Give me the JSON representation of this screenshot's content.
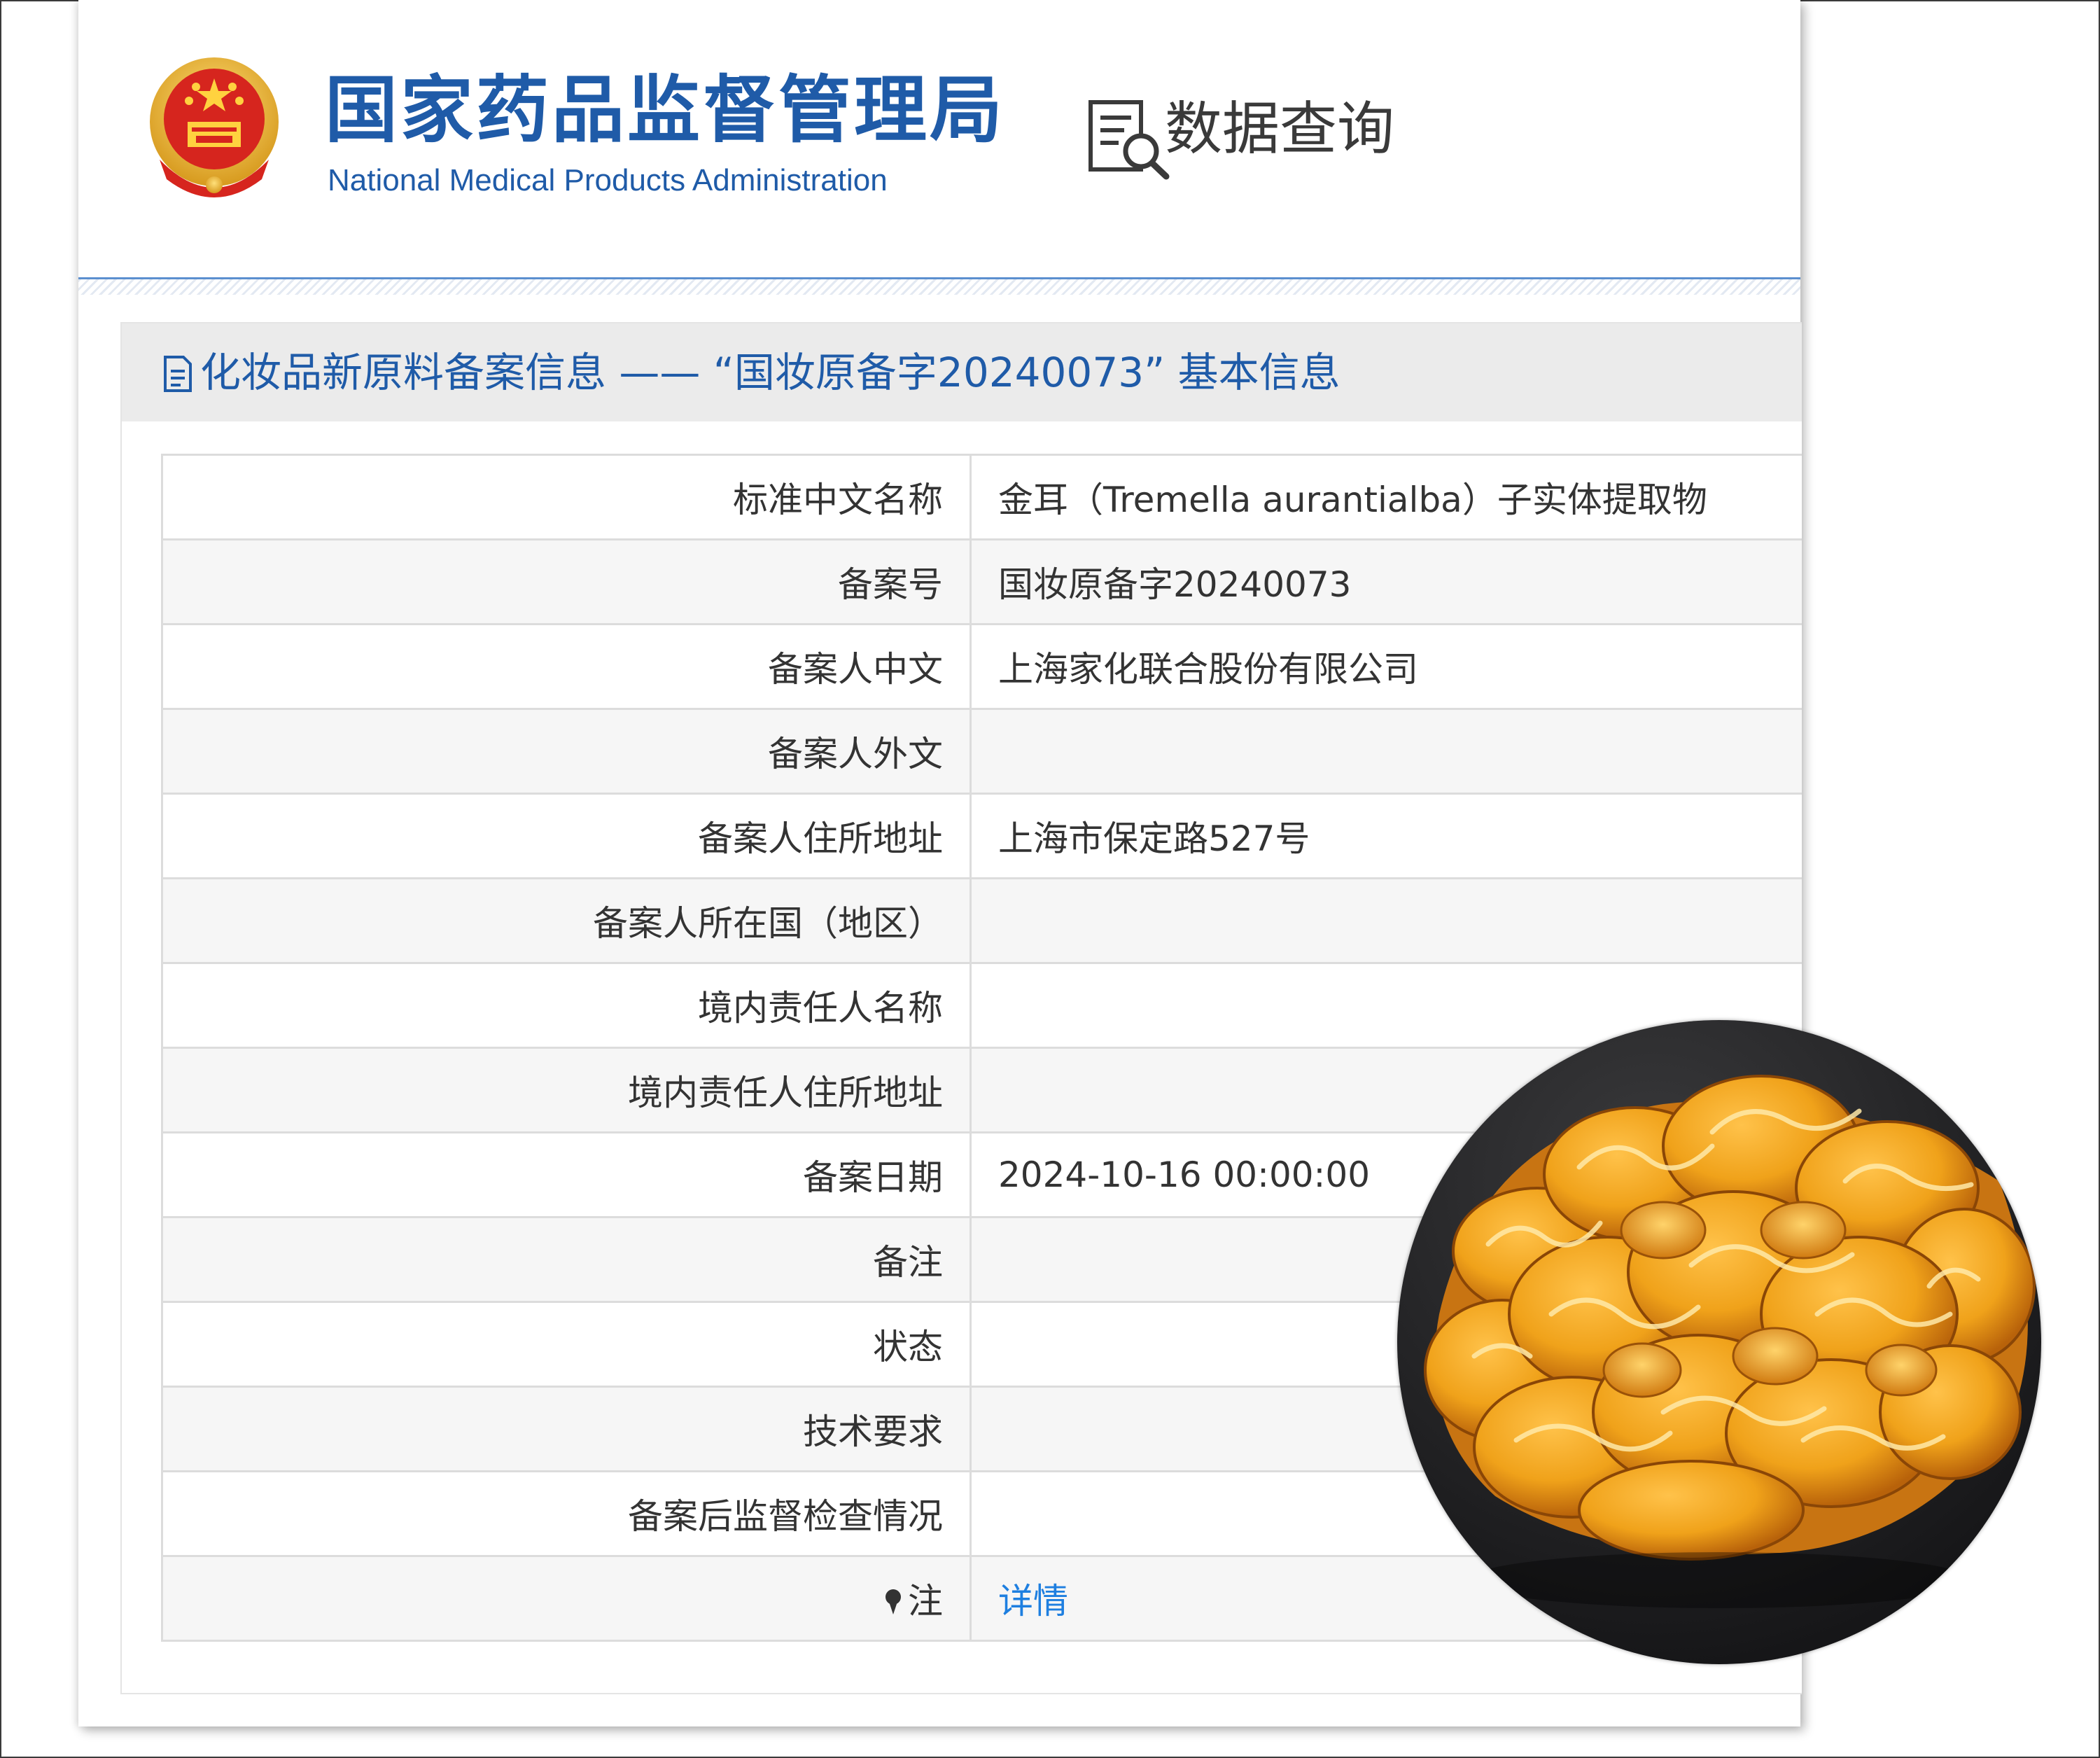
{
  "header": {
    "agency_name_cn": "国家药品监督管理局",
    "agency_name_en": "National Medical Products Administration",
    "section_label": "数据查询"
  },
  "panel": {
    "title": "化妆品新原料备案信息 —— “国妆原备字20240073” 基本信息"
  },
  "rows": [
    {
      "label": "标准中文名称",
      "value": "金耳（Tremella aurantialba）子实体提取物"
    },
    {
      "label": "备案号",
      "value": "国妆原备字20240073"
    },
    {
      "label": "备案人中文",
      "value": "上海家化联合股份有限公司"
    },
    {
      "label": "备案人外文",
      "value": ""
    },
    {
      "label": "备案人住所地址",
      "value": "上海市保定路527号"
    },
    {
      "label": "备案人所在国（地区）",
      "value": ""
    },
    {
      "label": "境内责任人名称",
      "value": ""
    },
    {
      "label": "境内责任人住所地址",
      "value": ""
    },
    {
      "label": "备案日期",
      "value": "2024-10-16 00:00:00"
    },
    {
      "label": "备注",
      "value": ""
    },
    {
      "label": "状态",
      "value": ""
    },
    {
      "label": "技术要求",
      "value": ""
    },
    {
      "label": "备案后监督检查情况",
      "value": ""
    },
    {
      "label": "注",
      "value": "详情"
    }
  ],
  "colors": {
    "brand_blue": "#1f5ba8",
    "link_blue": "#1e7fe0",
    "header_bg": "#ebebeb",
    "row_alt_bg": "#f6f6f6"
  },
  "icons": {
    "emblem": "national-emblem-icon",
    "data_query": "document-search-icon",
    "title": "document-icon",
    "note": "pushpin-icon"
  }
}
